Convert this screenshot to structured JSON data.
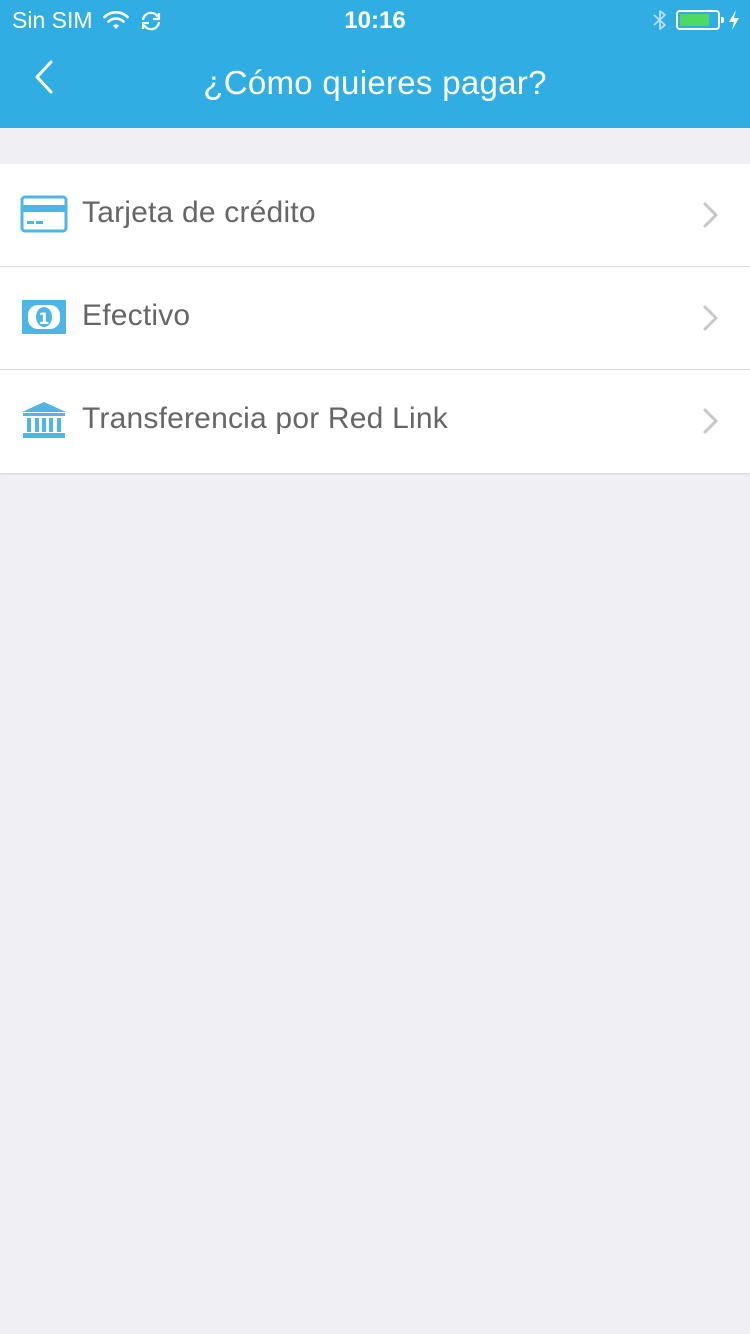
{
  "status_bar": {
    "carrier": "Sin SIM",
    "time": "10:16",
    "icons": [
      "wifi-icon",
      "sync-icon",
      "bluetooth-icon",
      "battery-icon",
      "charging-icon"
    ],
    "battery_level": 0.8
  },
  "nav": {
    "title": "¿Cómo quieres pagar?",
    "back_icon": "chevron-left-icon"
  },
  "payment_options": [
    {
      "label": "Tarjeta de crédito",
      "icon": "credit-card-icon"
    },
    {
      "label": "Efectivo",
      "icon": "banknote-icon"
    },
    {
      "label": "Transferencia por Red Link",
      "icon": "bank-icon"
    }
  ],
  "colors": {
    "brand": "#30aee3",
    "icon": "#4db6e6",
    "background": "#efeff4",
    "text": "#666666",
    "chevron": "#c7c7cc",
    "battery": "#4cd964"
  }
}
